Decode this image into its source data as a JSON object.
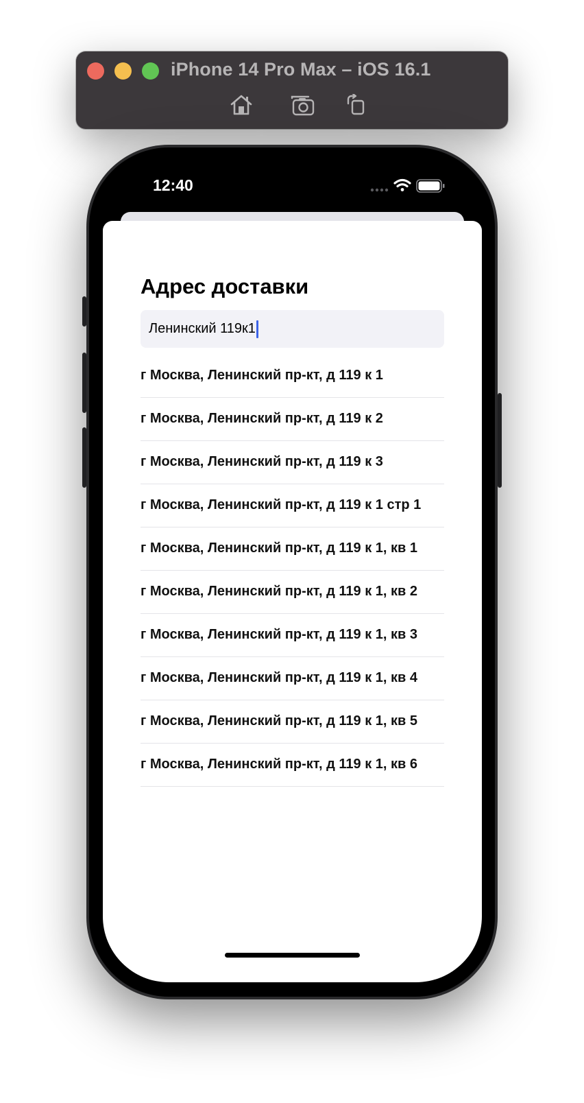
{
  "simulator": {
    "title": "iPhone 14 Pro Max – iOS 16.1",
    "buttons": [
      {
        "name": "home",
        "icon": "house-icon"
      },
      {
        "name": "screenshot",
        "icon": "camera-icon"
      },
      {
        "name": "rotate",
        "icon": "rotate-icon"
      }
    ]
  },
  "status_bar": {
    "time": "12:40",
    "icons": [
      "signal-dots-icon",
      "wifi-icon",
      "battery-icon"
    ]
  },
  "sheet": {
    "title": "Адрес доставки",
    "search": {
      "value": "Ленинский 119к1",
      "placeholder": ""
    },
    "results": [
      "г Москва, Ленинский пр-кт, д 119 к 1",
      "г Москва, Ленинский пр-кт, д 119 к 2",
      "г Москва, Ленинский пр-кт, д 119 к 3",
      "г Москва, Ленинский пр-кт, д 119 к 1 стр 1",
      "г Москва, Ленинский пр-кт, д 119 к 1, кв 1",
      "г Москва, Ленинский пр-кт, д 119 к 1, кв 2",
      "г Москва, Ленинский пр-кт, д 119 к 1, кв 3",
      "г Москва, Ленинский пр-кт, д 119 к 1, кв 4",
      "г Москва, Ленинский пр-кт, д 119 к 1, кв 5",
      "г Москва, Ленинский пр-кт, д 119 к 1, кв 6"
    ]
  },
  "colors": {
    "toolbar_bg": "#3c383b",
    "close": "#ed6a5e",
    "minimize": "#f5bf4f",
    "maximize": "#61c554",
    "caret": "#3d64e8",
    "field_bg": "#f2f2f7"
  }
}
